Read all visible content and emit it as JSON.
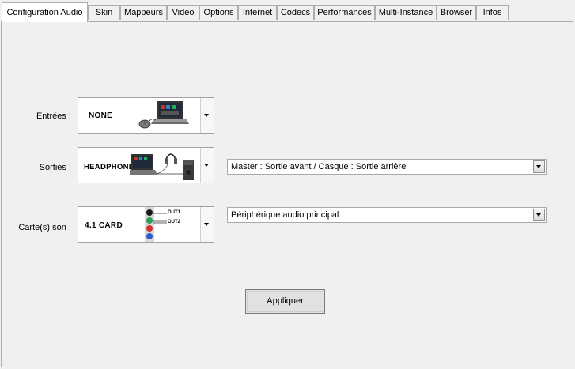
{
  "tabs": [
    {
      "label": "Configuration Audio",
      "active": true
    },
    {
      "label": "Skin"
    },
    {
      "label": "Mappeurs"
    },
    {
      "label": "Video"
    },
    {
      "label": "Options"
    },
    {
      "label": "Internet"
    },
    {
      "label": "Codecs"
    },
    {
      "label": "Performances"
    },
    {
      "label": "Multi-Instance"
    },
    {
      "label": "Browser"
    },
    {
      "label": "Infos"
    }
  ],
  "inputs": {
    "label": "Entrées :",
    "device": "NONE"
  },
  "outputs": {
    "label": "Sorties :",
    "device": "HEADPHONES",
    "routing": "Master : Sortie avant / Casque : Sortie arrière"
  },
  "soundcard": {
    "label": "Carte(s) son :",
    "device": "4.1 CARD",
    "out1": "OUT1",
    "out2": "OUT2",
    "device_select": "Périphérique audio principal"
  },
  "apply_label": "Appliquer",
  "colors": {
    "panel_bg": "#f0f0f0",
    "jack_black": "#1a1a1a",
    "jack_green": "#2e9e5a",
    "jack_red": "#d23030",
    "jack_blue": "#2c5fc8"
  }
}
